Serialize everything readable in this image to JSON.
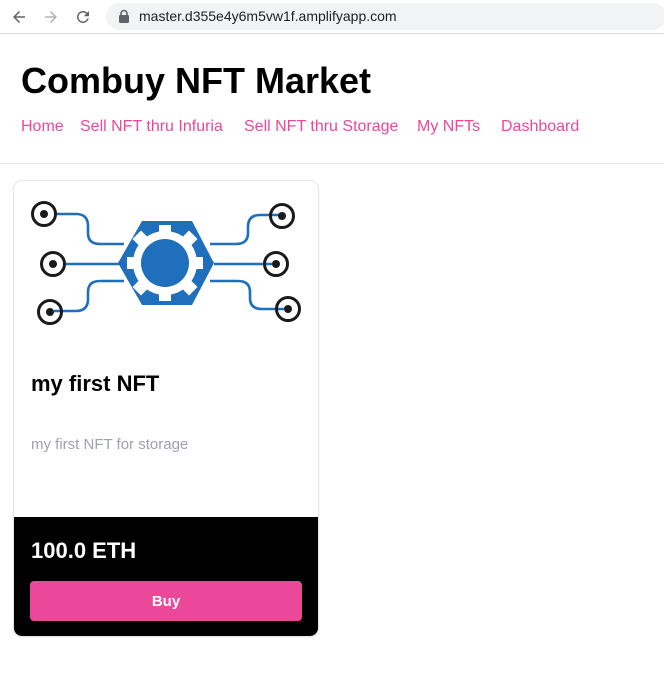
{
  "browser": {
    "url": "master.d355e4y6m5vw1f.amplifyapp.com"
  },
  "header": {
    "title": "Combuy NFT Market",
    "nav": [
      {
        "label": "Home"
      },
      {
        "label": "Sell NFT thru Infuria"
      },
      {
        "label": "Sell NFT thru Storage"
      },
      {
        "label": "My NFTs"
      },
      {
        "label": "Dashboard"
      }
    ]
  },
  "nft": {
    "name": "my first NFT",
    "description": "my first NFT for storage",
    "price": "100.0 ETH",
    "buy_label": "Buy",
    "image_icon": "network-gear-icon"
  },
  "colors": {
    "accent": "#ec4899",
    "gear_blue": "#1f6fbd",
    "footer_bg": "#000000",
    "muted_text": "#9ca3af"
  }
}
